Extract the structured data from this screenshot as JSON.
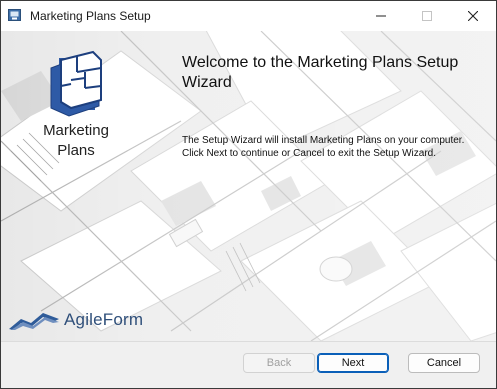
{
  "window": {
    "title": "Marketing Plans Setup"
  },
  "sidebar": {
    "product_name_line1": "Marketing",
    "product_name_line2": "Plans",
    "brand_name": "AgileForm"
  },
  "main": {
    "heading": "Welcome to the Marketing Plans Setup Wizard",
    "description": "The Setup Wizard will install Marketing Plans on your computer. Click Next to continue or Cancel to exit the Setup Wizard."
  },
  "buttons": {
    "back": "Back",
    "next": "Next",
    "cancel": "Cancel"
  },
  "icons": {
    "app": "installer-icon",
    "logo": "floorplan-logo-icon",
    "brand": "agileform-mark-icon"
  },
  "colors": {
    "brand": "#2f4f7a",
    "logo_fill": "#2e5aa6",
    "default_button_border": "#0a5fb8"
  }
}
